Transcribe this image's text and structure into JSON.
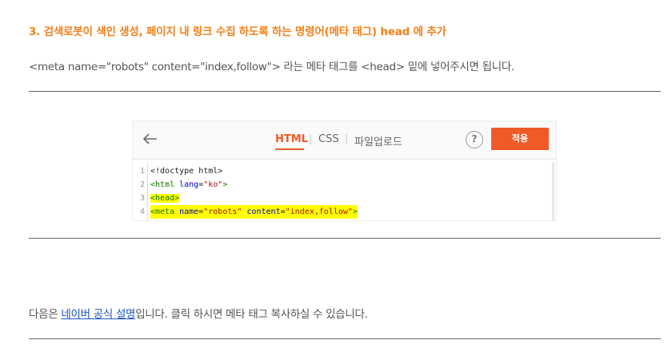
{
  "heading": "3. 검색로봇이 색인 생성, 페이지 내 링크 수집 하도록 하는 명령어(메타 태그) head 에 추가",
  "paragraph1": "<meta name=\"robots\" content=\"index,follow\"> 라는 메타 태그를 <head> 밑에 넣어주시면 됩니다.",
  "editor": {
    "tabs": {
      "html": "HTML",
      "css": "CSS",
      "upload": "파일업로드"
    },
    "separator": "|",
    "help": "?",
    "apply": "적용",
    "lines": [
      {
        "num": "1",
        "text": "<!doctype html>"
      },
      {
        "num": "2",
        "tag_open": "<html ",
        "attr": "lang",
        "eq": "=",
        "str": "\"ko\"",
        "tag_close": ">"
      },
      {
        "num": "3",
        "text": "<head>"
      },
      {
        "num": "4",
        "tag_open": "<meta ",
        "attr1": "name",
        "eq1": "=",
        "str1": "\"robots\"",
        "attr2": "content",
        "eq2": "=",
        "str2": "\"index,follow\"",
        "tag_close": ">"
      }
    ]
  },
  "paragraph2": {
    "before": "다음은 ",
    "link": "네이버 공식 설명",
    "after": "입니다. 클릭 하시면 메타 태그 복사하실 수 있습니다."
  },
  "colors": {
    "accent": "#f0801a",
    "apply_button": "#f05a28",
    "link": "#1a55c4",
    "highlight": "#ffff00"
  }
}
